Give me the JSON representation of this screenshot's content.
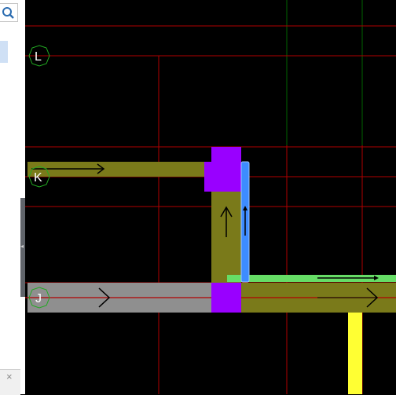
{
  "sidebar": {
    "search_icon": "search-icon",
    "close_label": "×"
  },
  "canvas": {
    "grid_labels": [
      "L",
      "K",
      "J"
    ],
    "colors": {
      "background": "#000000",
      "grid_red": "#b00000",
      "grid_green": "#006400",
      "duct_olive": "#7a7a1a",
      "duct_gray": "#8f8f8f",
      "fitting_purple": "#9900ff",
      "selected_blue": "#3d8cff",
      "pipe_green": "#66dd66",
      "pipe_yellow": "#ffff33",
      "label_ring": "#22aa22"
    }
  }
}
